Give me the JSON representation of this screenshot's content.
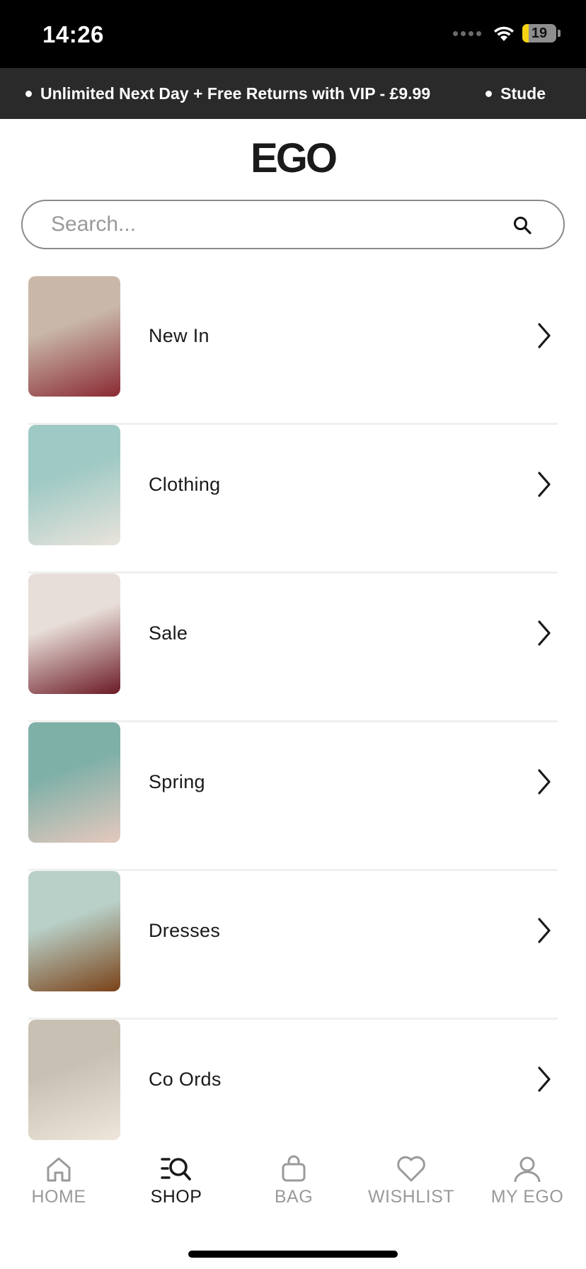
{
  "status_bar": {
    "time": "14:26",
    "battery_level": "19",
    "battery_fraction": 0.19,
    "battery_color": "#f5d312"
  },
  "promo": {
    "items": [
      "Unlimited Next Day + Free Returns with VIP - £9.99",
      "Stude"
    ]
  },
  "header": {
    "logo": "EGO"
  },
  "search": {
    "placeholder": "Search...",
    "value": "",
    "icon": "search-icon"
  },
  "categories": [
    {
      "label": "New In",
      "icon": "chevron-right-icon",
      "thumb_colors": [
        "#c9b8aa",
        "#8a2a32"
      ]
    },
    {
      "label": "Clothing",
      "icon": "chevron-right-icon",
      "thumb_colors": [
        "#9fc9c4",
        "#e9e4dc"
      ]
    },
    {
      "label": "Sale",
      "icon": "chevron-right-icon",
      "thumb_colors": [
        "#e8ded9",
        "#6b1a24"
      ]
    },
    {
      "label": "Spring",
      "icon": "chevron-right-icon",
      "thumb_colors": [
        "#7fb0a8",
        "#e6c9be"
      ]
    },
    {
      "label": "Dresses",
      "icon": "chevron-right-icon",
      "thumb_colors": [
        "#b8d0c8",
        "#7a4218"
      ]
    },
    {
      "label": "Co Ords",
      "icon": "chevron-right-icon",
      "thumb_colors": [
        "#c8c0b2",
        "#efe6dc"
      ]
    }
  ],
  "tab_bar": {
    "tabs": [
      {
        "label": "HOME",
        "icon": "home-icon",
        "active": false
      },
      {
        "label": "SHOP",
        "icon": "shop-search-icon",
        "active": true
      },
      {
        "label": "BAG",
        "icon": "bag-icon",
        "active": false
      },
      {
        "label": "WISHLIST",
        "icon": "heart-icon",
        "active": false
      },
      {
        "label": "MY EGO",
        "icon": "user-icon",
        "active": false
      }
    ]
  }
}
